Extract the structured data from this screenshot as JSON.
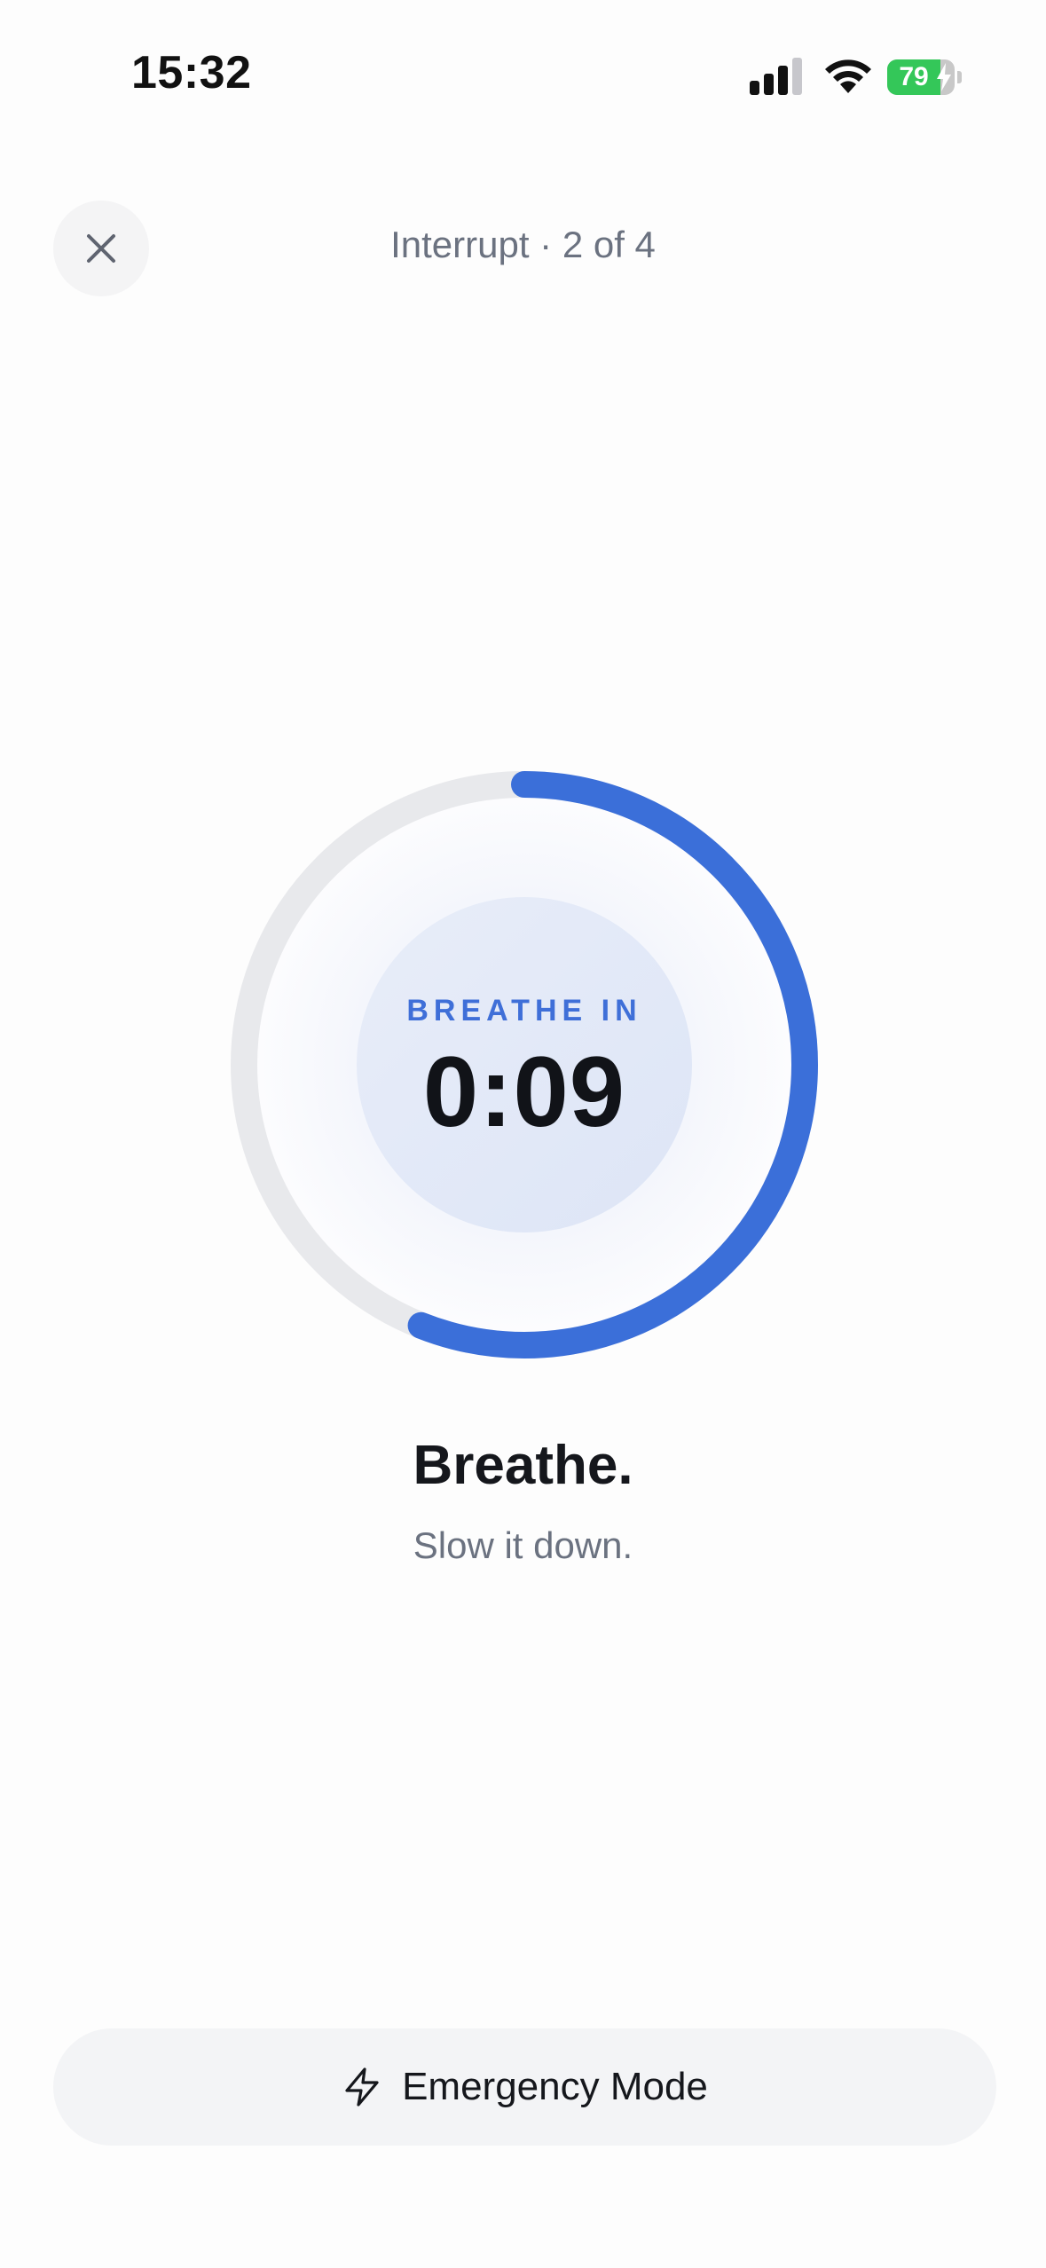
{
  "status_bar": {
    "time": "15:32",
    "battery_percent": "79",
    "battery_level": 0.79,
    "charging": true,
    "icons": [
      "signal-icon",
      "wifi-icon",
      "battery-icon"
    ]
  },
  "header": {
    "close_icon": "close-icon",
    "title": "Interrupt · 2 of 4"
  },
  "timer": {
    "phase": "BREATHE IN",
    "countdown": "0:09",
    "progress": 0.56
  },
  "message": {
    "title": "Breathe.",
    "subtitle": "Slow it down."
  },
  "emergency": {
    "icon": "bolt-icon",
    "label": "Emergency Mode"
  },
  "colors": {
    "accent": "#3b6fd9",
    "track": "#e8e9ec",
    "battery": "#34c759"
  }
}
